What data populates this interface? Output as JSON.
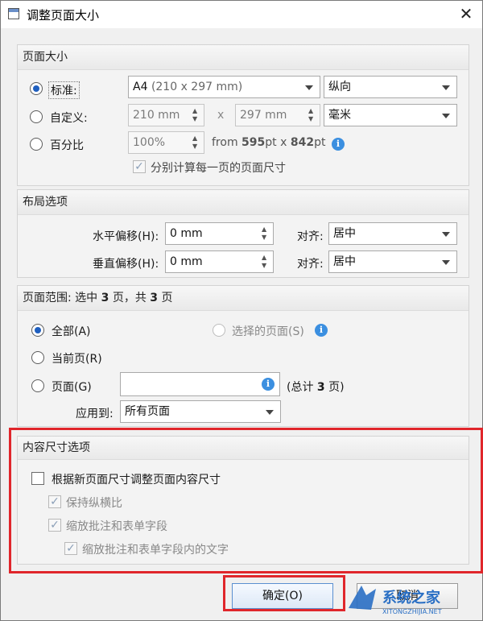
{
  "window": {
    "title": "调整页面大小",
    "close_glyph": "✕"
  },
  "page_size": {
    "header": "页面大小",
    "standard_label": "标准:",
    "standard_value": "A4",
    "standard_dims": "(210 x 297 mm)",
    "orientation_value": "纵向",
    "custom_label": "自定义:",
    "custom_width": "210 mm",
    "times": "x",
    "custom_height": "297 mm",
    "unit_value": "毫米",
    "percent_label": "百分比",
    "percent_value": "100%",
    "from_prefix": "from",
    "from_w": "595",
    "from_pt1": "pt x",
    "from_h": "842",
    "from_pt2": "pt",
    "each_page_label": "分别计算每一页的页面尺寸"
  },
  "layout": {
    "header": "布局选项",
    "h_offset_label": "水平偏移(H):",
    "h_offset_value": "0 mm",
    "v_offset_label": "垂直偏移(H):",
    "v_offset_value": "0 mm",
    "align_label_1": "对齐:",
    "align_value_1": "居中",
    "align_label_2": "对齐:",
    "align_value_2": "居中"
  },
  "page_range": {
    "header_prefix": "页面范围: 选中 ",
    "header_count_1": "3",
    "header_mid": " 页，共 ",
    "header_count_2": "3",
    "header_suffix": " 页",
    "all_label": "全部(A)",
    "selected_label": "选择的页面(S)",
    "current_label": "当前页(R)",
    "pages_label": "页面(G)",
    "pages_value": "",
    "total_prefix": "(总计 ",
    "total_count": "3",
    "total_suffix": " 页)",
    "apply_label": "应用到:",
    "apply_value": "所有页面"
  },
  "content": {
    "header": "内容尺寸选项",
    "resize_label": "根据新页面尺寸调整页面内容尺寸",
    "keep_ratio_label": "保持纵横比",
    "scale_annot_label": "缩放批注和表单字段",
    "scale_text_label": "缩放批注和表单字段内的文字"
  },
  "buttons": {
    "ok_label": "确定(O)",
    "cancel_label": "取消"
  },
  "watermark": {
    "brand": "系统之家",
    "url": "XITONGZHIJIA.NET"
  },
  "colors": {
    "highlight_red": "#e0262b",
    "radio_accent": "#1f5fbf",
    "info_blue": "#3b8fe0"
  },
  "icons": [
    "app-icon",
    "close-icon",
    "info-icon",
    "dropdown-arrow-icon",
    "spin-icon",
    "check-icon"
  ]
}
